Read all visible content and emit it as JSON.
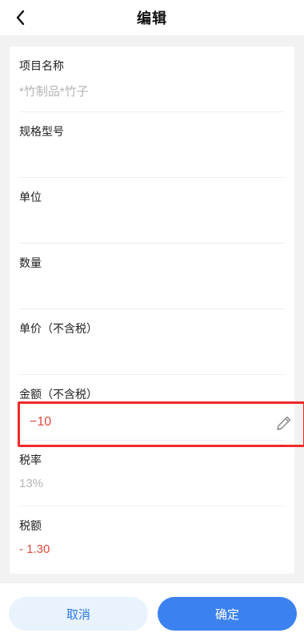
{
  "header": {
    "title": "编辑"
  },
  "fields": {
    "item_name": {
      "label": "项目名称",
      "placeholder": "*竹制品*竹子"
    },
    "spec": {
      "label": "规格型号",
      "value": ""
    },
    "unit": {
      "label": "单位",
      "value": ""
    },
    "quantity": {
      "label": "数量",
      "value": ""
    },
    "unit_price": {
      "label": "单价（不含税）",
      "value": ""
    },
    "amount": {
      "label": "金额（不含税）",
      "value": "−10"
    },
    "tax_rate": {
      "label": "税率",
      "value": "13%"
    },
    "tax_amount": {
      "label": "税额",
      "value": "- 1.30"
    }
  },
  "buttons": {
    "cancel": "取消",
    "confirm": "确定"
  },
  "icons": {
    "back": "chevron-left-icon",
    "edit": "pencil-icon"
  },
  "colors": {
    "accent": "#3b82f0",
    "negative": "#e04a3b",
    "highlight_border": "#ef2a2a",
    "placeholder": "#b5b5b5"
  }
}
